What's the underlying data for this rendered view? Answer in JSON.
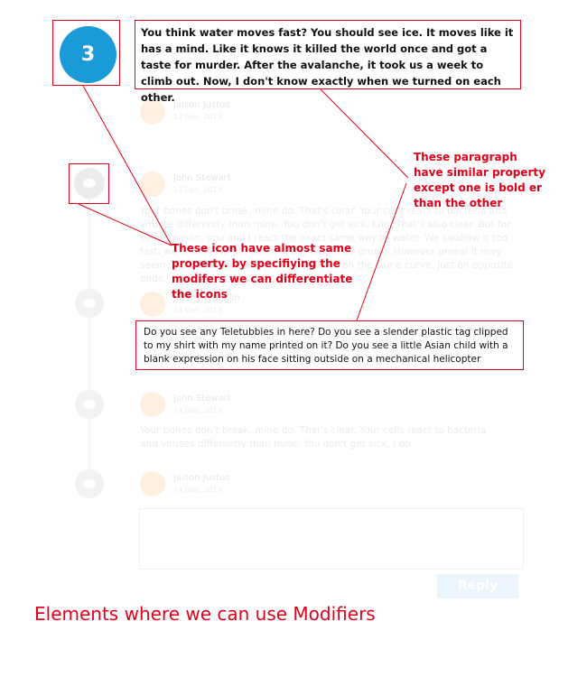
{
  "numbered_badge": "3",
  "bold_quote": "You think water moves fast? You should see ice. It moves like it has a mind. Like it knows it killed the world once and got a taste for murder. After the avalanche, it took us a week to climb out. Now, I don't know exactly when we turned on each other.",
  "normal_quote": "Do you see any Teletubbies in here? Do you see a slender plastic tag clipped to my shirt with my name printed on it? Do you see a little Asian child with a blank expression on his face sitting outside on a mechanical helicopter",
  "annotations": {
    "paragraph_note": "These paragraph have similar property except one is bold er than the other",
    "icon_note": "These icon have almost same property. by specifiying the modifers we can differentiate the icons"
  },
  "comments": [
    {
      "name": "Jaison Justus",
      "date": "12 Dec, 2013",
      "text": ""
    },
    {
      "name": "John Stewart",
      "date": "13 Dec, 2013",
      "text": "Your bones don't break, mine do. That's clear. Your cells react to bacteria and viruses differently than mine. You don't get sick, I do. That's also clear. But for some reason, you and I react the exact same way to water. We swallow it too fast, we choke. We get some in our lungs, we drown. However unreal it may seem, we are connected, you and I. We're on the same curve, just on opposite ends."
    },
    {
      "name": "Jimmy Franklin",
      "date": "14 Dec, 2013",
      "text": ""
    },
    {
      "name": "John Stewart",
      "date": "14 Dec, 2013",
      "text": "Your bones don't break, mine do. That's clear. Your cells react to bacteria and viruses differently than mine. You don't get sick, I do."
    },
    {
      "name": "Jaison Justus",
      "date": "14 Dec, 2013",
      "text": ""
    }
  ],
  "reply_label": "Reply",
  "footer_title": "Elements where we can use Modifiers",
  "colors": {
    "annotation_red": "#e1001a",
    "badge_blue": "#1a9ad6"
  }
}
